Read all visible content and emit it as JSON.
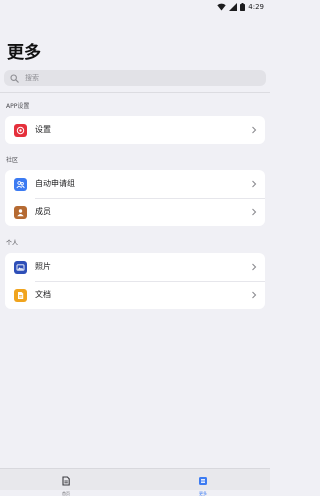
{
  "status_bar": {
    "time": "4:29"
  },
  "header": {
    "title": "更多"
  },
  "search": {
    "placeholder": "搜索",
    "value": ""
  },
  "sections": [
    {
      "header": "APP设置",
      "items": [
        {
          "label": "设置",
          "icon": "settings-icon",
          "color": "#e5303c"
        }
      ]
    },
    {
      "header": "社区",
      "items": [
        {
          "label": "自动申请组",
          "icon": "group-icon",
          "color": "#3c7bf2"
        },
        {
          "label": "成员",
          "icon": "member-icon",
          "color": "#b56a32"
        }
      ]
    },
    {
      "header": "个人",
      "items": [
        {
          "label": "照片",
          "icon": "photo-icon",
          "color": "#2e4fb8"
        },
        {
          "label": "文档",
          "icon": "document-icon",
          "color": "#f0a41e"
        }
      ]
    }
  ],
  "tab_bar": {
    "tabs": [
      {
        "label": "首页",
        "icon": "home-icon",
        "active": false
      },
      {
        "label": "更多",
        "icon": "more-icon",
        "active": true
      }
    ],
    "accent": "#3c7bf2"
  }
}
